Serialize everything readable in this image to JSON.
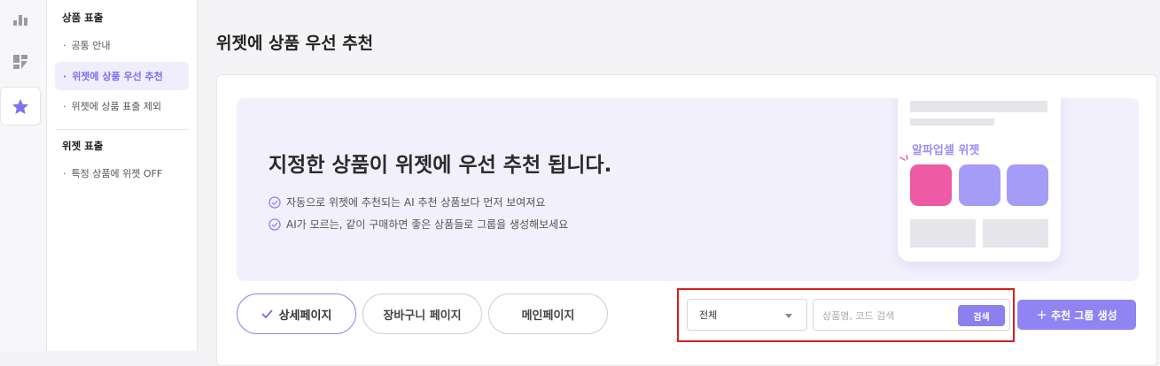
{
  "rail": {
    "icons": [
      "bar-chart-icon",
      "dashboard-icon",
      "star-icon"
    ]
  },
  "sidebar": {
    "sections": [
      {
        "title": "상품 표출",
        "items": [
          {
            "label": "공통 안내",
            "active": false
          },
          {
            "label": "위젯에 상품 우선 추천",
            "active": true
          },
          {
            "label": "위젯에 상품 표출 제외",
            "active": false
          }
        ]
      },
      {
        "title": "위젯 표출",
        "items": [
          {
            "label": "특정 상품에 위젯 OFF",
            "active": false
          }
        ]
      }
    ],
    "bullet": "·"
  },
  "page": {
    "title": "위젯에 상품 우선 추천"
  },
  "banner": {
    "headline": "지정한 상품이 위젯에 우선 추천 됩니다.",
    "bullets": [
      "자동으로 위젯에 추천되는 AI 추천 상품보다 먼저 보여져요",
      "AI가 모르는, 같이 구매하면 좋은 상품들로 그룹을 생성해보세요"
    ],
    "widget_label": "알파업셀 위젯",
    "colors": {
      "bg": "#f1f0fc",
      "tile_primary": "#ee5aa6",
      "tile_secondary": "#a59cf8",
      "accent": "#8f84f2"
    }
  },
  "tabs": [
    {
      "label": "상세페이지",
      "active": true
    },
    {
      "label": "장바구니 페이지",
      "active": false
    },
    {
      "label": "메인페이지",
      "active": false
    }
  ],
  "filter": {
    "selected": "전체",
    "search_placeholder": "상품명, 코드 검색",
    "search_button": "검색"
  },
  "create_button": {
    "plus": "+",
    "label": "추천 그룹 생성"
  }
}
